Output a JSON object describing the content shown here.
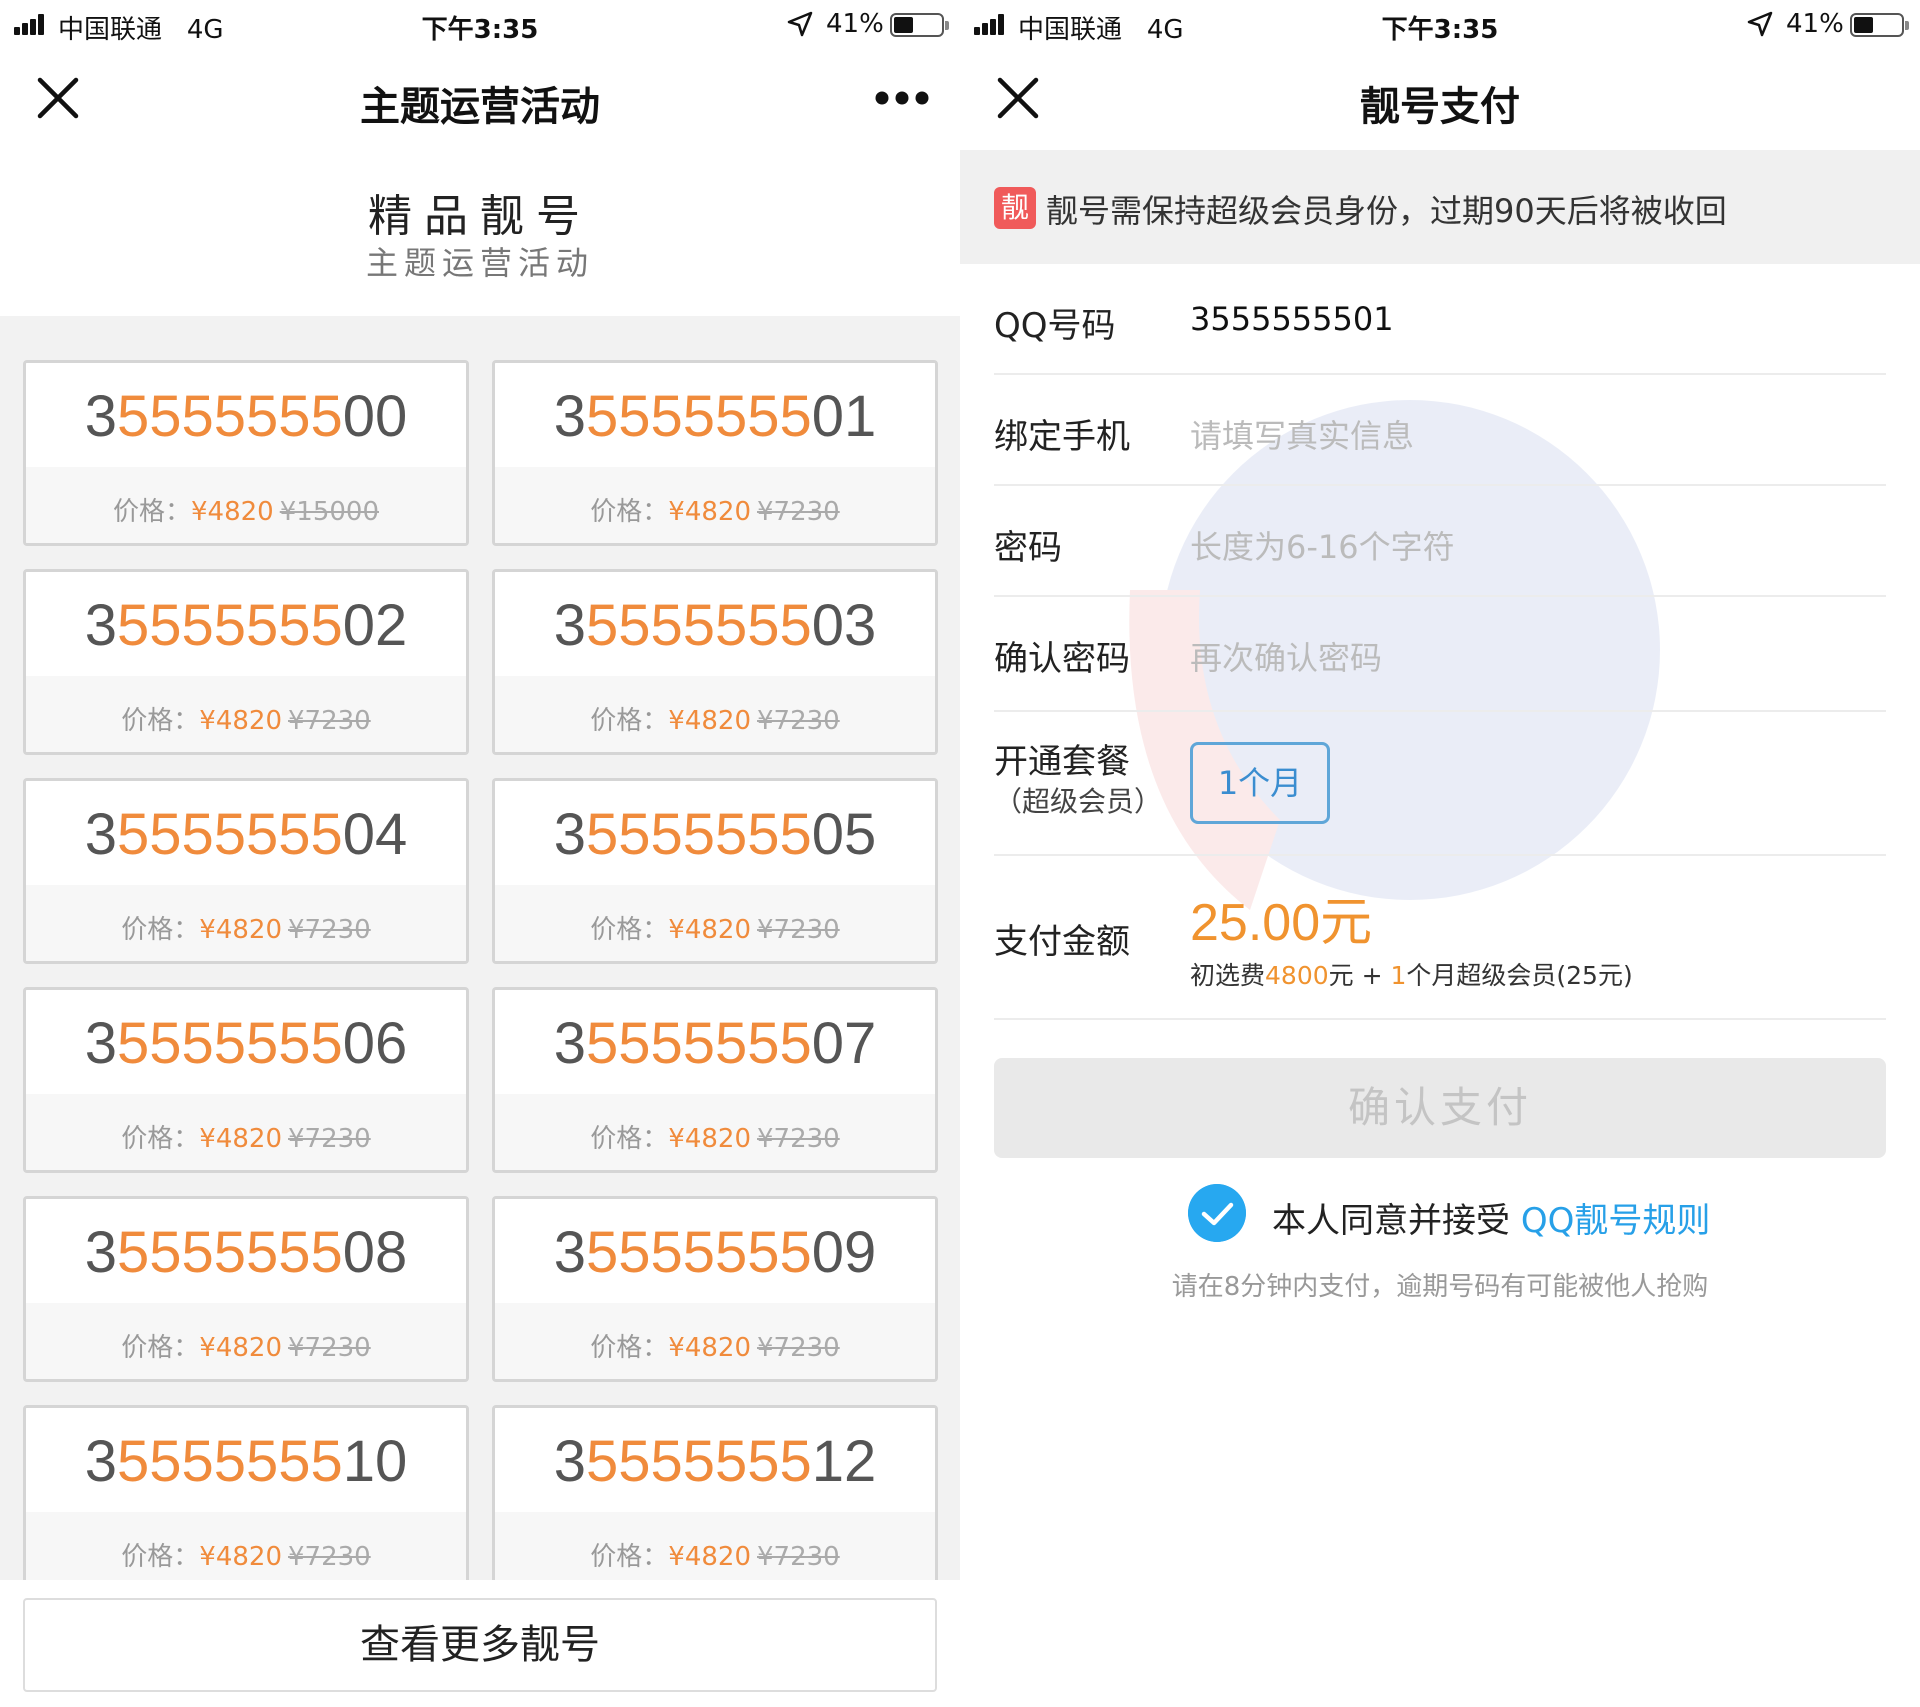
{
  "status_bar": {
    "carrier": "中国联通",
    "network": "4G",
    "time": "下午3:35",
    "battery_percent": "41%",
    "battery_level": 0.41
  },
  "left": {
    "nav": {
      "title": "主题运营活动",
      "close_icon": "close-icon",
      "more_icon": "more-icon"
    },
    "header": {
      "title": "精品靓号",
      "subtitle": "主题运营活动"
    },
    "price_label": "价格：",
    "cards": [
      {
        "prefix": "3",
        "mid": "5555555",
        "suffix": "00",
        "price": "¥4820",
        "original": "¥15000"
      },
      {
        "prefix": "3",
        "mid": "5555555",
        "suffix": "01",
        "price": "¥4820",
        "original": "¥7230"
      },
      {
        "prefix": "3",
        "mid": "5555555",
        "suffix": "02",
        "price": "¥4820",
        "original": "¥7230"
      },
      {
        "prefix": "3",
        "mid": "5555555",
        "suffix": "03",
        "price": "¥4820",
        "original": "¥7230"
      },
      {
        "prefix": "3",
        "mid": "5555555",
        "suffix": "04",
        "price": "¥4820",
        "original": "¥7230"
      },
      {
        "prefix": "3",
        "mid": "5555555",
        "suffix": "05",
        "price": "¥4820",
        "original": "¥7230"
      },
      {
        "prefix": "3",
        "mid": "5555555",
        "suffix": "06",
        "price": "¥4820",
        "original": "¥7230"
      },
      {
        "prefix": "3",
        "mid": "5555555",
        "suffix": "07",
        "price": "¥4820",
        "original": "¥7230"
      },
      {
        "prefix": "3",
        "mid": "5555555",
        "suffix": "08",
        "price": "¥4820",
        "original": "¥7230"
      },
      {
        "prefix": "3",
        "mid": "5555555",
        "suffix": "09",
        "price": "¥4820",
        "original": "¥7230"
      },
      {
        "prefix": "3",
        "mid": "5555555",
        "suffix": "10",
        "price": "¥4820",
        "original": "¥7230"
      },
      {
        "prefix": "3",
        "mid": "5555555",
        "suffix": "12",
        "price": "¥4820",
        "original": "¥7230"
      }
    ],
    "more_button": "查看更多靓号"
  },
  "right": {
    "nav": {
      "title": "靓号支付",
      "close_icon": "close-icon"
    },
    "notice": {
      "badge": "靓",
      "text": "靓号需保持超级会员身份，过期90天后将被收回"
    },
    "form": {
      "qq": {
        "label": "QQ号码",
        "value": "3555555501"
      },
      "phone": {
        "label": "绑定手机",
        "placeholder": "请填写真实信息"
      },
      "password": {
        "label": "密码",
        "placeholder": "长度为6-16个字符"
      },
      "confirm": {
        "label": "确认密码",
        "placeholder": "再次确认密码"
      },
      "package": {
        "label": "开通套餐",
        "sublabel": "（超级会员）",
        "option": "1个月"
      },
      "payment": {
        "label": "支付金额",
        "amount": "25.00元",
        "detail_prefix": "初选费",
        "detail_fee": "4800",
        "detail_mid": "元 + ",
        "detail_months": "1",
        "detail_suffix": "个月超级会员(25元)"
      }
    },
    "confirm_button": "确认支付",
    "agreement": {
      "checked": true,
      "text": "本人同意并接受 ",
      "link": "QQ靓号规则"
    },
    "tip": "请在8分钟内支付，逾期号码有可能被他人抢购"
  },
  "colors": {
    "accent_orange": "#f08b3c",
    "link_blue": "#27a0e8",
    "badge_red": "#f05a5a",
    "check_blue": "#27a8f0"
  }
}
